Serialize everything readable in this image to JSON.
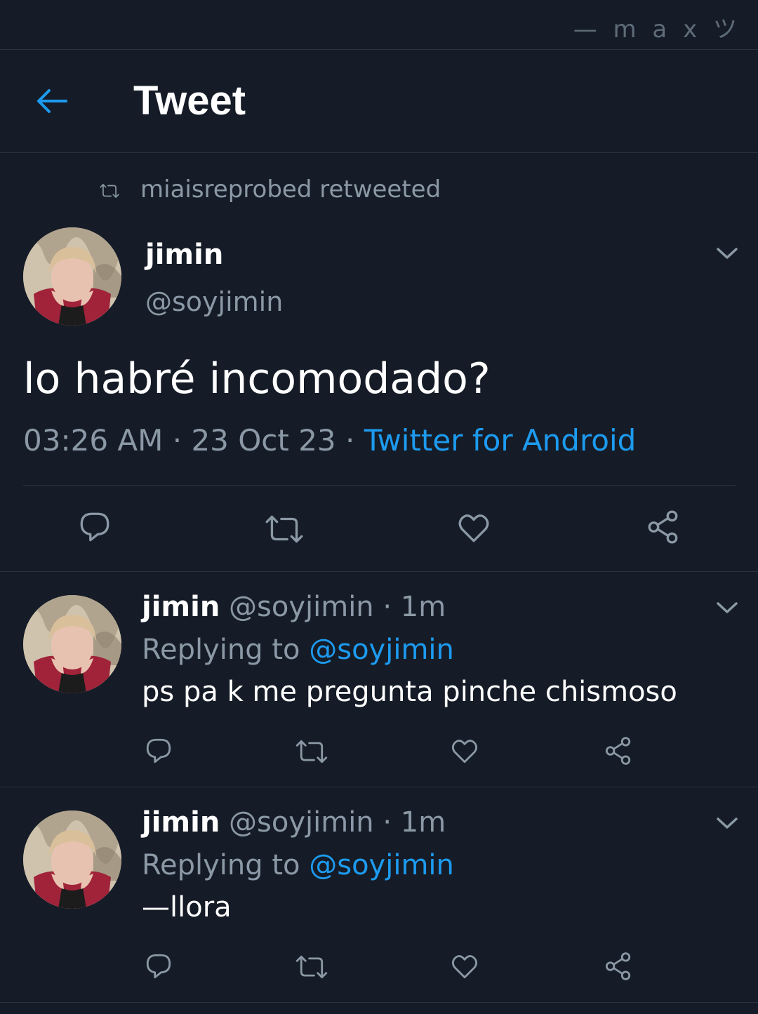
{
  "watermark": "— m a x ツ",
  "header": {
    "title": "Tweet"
  },
  "retweet_line": "miaisreprobed retweeted",
  "main_tweet": {
    "name": "jimin",
    "handle": "@soyjimin",
    "text": "lo habré incomodado?",
    "time": "03:26 AM",
    "date": "23 Oct 23",
    "source": "Twitter for Android",
    "sep": "·"
  },
  "replies": [
    {
      "name": "jimin",
      "handle_time": "@soyjimin · 1m",
      "replying_prefix": "Replying to",
      "replying_to": "@soyjimin",
      "text": "ps pa k me pregunta pinche chismoso"
    },
    {
      "name": "jimin",
      "handle_time": "@soyjimin · 1m",
      "replying_prefix": "Replying to",
      "replying_to": "@soyjimin",
      "text": "—llora"
    }
  ],
  "colors": {
    "background": "#151c27",
    "accent": "#1d9bf0",
    "secondary_text": "#8b98a5",
    "divider": "#2a3340"
  },
  "icons": [
    "back-arrow-icon",
    "retweet-icon",
    "chevron-down-icon",
    "reply-icon",
    "like-icon",
    "share-icon"
  ]
}
